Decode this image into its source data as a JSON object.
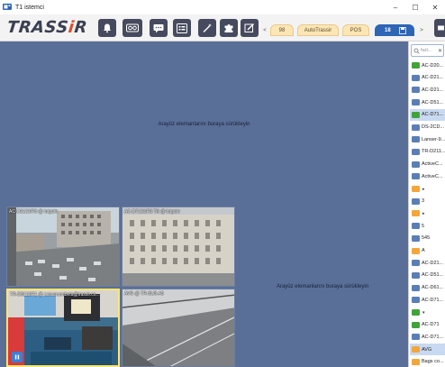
{
  "window": {
    "title": "T1 istemci",
    "minimize": "–",
    "maximize": "☐",
    "close": "✕"
  },
  "toolbar": {
    "logo_main": "TRASS",
    "logo_accent": "i",
    "logo_end": "R",
    "buttons": [
      "bell-icon",
      "tape-icon",
      "chat-icon",
      "list-icon",
      "wand-icon",
      "puzzle-icon",
      "edit-icon"
    ]
  },
  "tabs": {
    "prev": "<",
    "items": [
      {
        "label": "98",
        "active": false
      },
      {
        "label": "AutoTrassir",
        "active": false
      },
      {
        "label": "POS",
        "active": false
      },
      {
        "label": "18",
        "active": true
      }
    ],
    "next": ">"
  },
  "main": {
    "drop_top": "Arayüz elemanlarını buraya sürükleyin",
    "drop_bottom": "Arayüz elemanlarını buraya sürükleyin",
    "cameras": [
      {
        "label": "AC-D2121IR3 @ lutgate"
      },
      {
        "label": "AC-D7121IR3 Tilt @ lutgate"
      },
      {
        "label": "TR-D8111IR1 @ t.ssvsruonbeta@trassir.co..."
      },
      {
        "label": "AVG @ TR-SU3-A5"
      }
    ]
  },
  "sidebar": {
    "search_placeholder": "hızl...",
    "search_clear": "✕",
    "items": [
      {
        "label": "AC-D20...",
        "icon": "green"
      },
      {
        "label": "AC-D21...",
        "icon": "blue"
      },
      {
        "label": "AC-D21...",
        "icon": "blue"
      },
      {
        "label": "AC-D51...",
        "icon": "blue"
      },
      {
        "label": "AC-D71...",
        "icon": "green",
        "selected": true
      },
      {
        "label": "DS-2CD...",
        "icon": "blue"
      },
      {
        "label": "Lanser-9...",
        "icon": "blue"
      },
      {
        "label": "TR-D211...",
        "icon": "blue"
      },
      {
        "label": "ActiveC...",
        "icon": "blue"
      },
      {
        "label": "ActiveC...",
        "icon": "blue"
      },
      {
        "label": "",
        "icon": "orange",
        "arrow": "▸"
      },
      {
        "label": "3",
        "icon": "blue"
      },
      {
        "label": "",
        "icon": "orange",
        "arrow": "▸"
      },
      {
        "label": "5",
        "icon": "blue"
      },
      {
        "label": "545",
        "icon": "blue"
      },
      {
        "label": "A",
        "icon": "orange"
      },
      {
        "label": "AC-D21...",
        "icon": "blue"
      },
      {
        "label": "AC-D51...",
        "icon": "blue"
      },
      {
        "label": "AC-D61...",
        "icon": "blue"
      },
      {
        "label": "AC-D71...",
        "icon": "blue"
      },
      {
        "label": "",
        "icon": "green",
        "arrow": "▾"
      },
      {
        "label": "AC-D71",
        "icon": "green"
      },
      {
        "label": "AC-D71...",
        "icon": "blue"
      },
      {
        "label": "AVG",
        "icon": "orange",
        "selected": true
      },
      {
        "label": "Bags co...",
        "icon": "orange"
      }
    ]
  }
}
